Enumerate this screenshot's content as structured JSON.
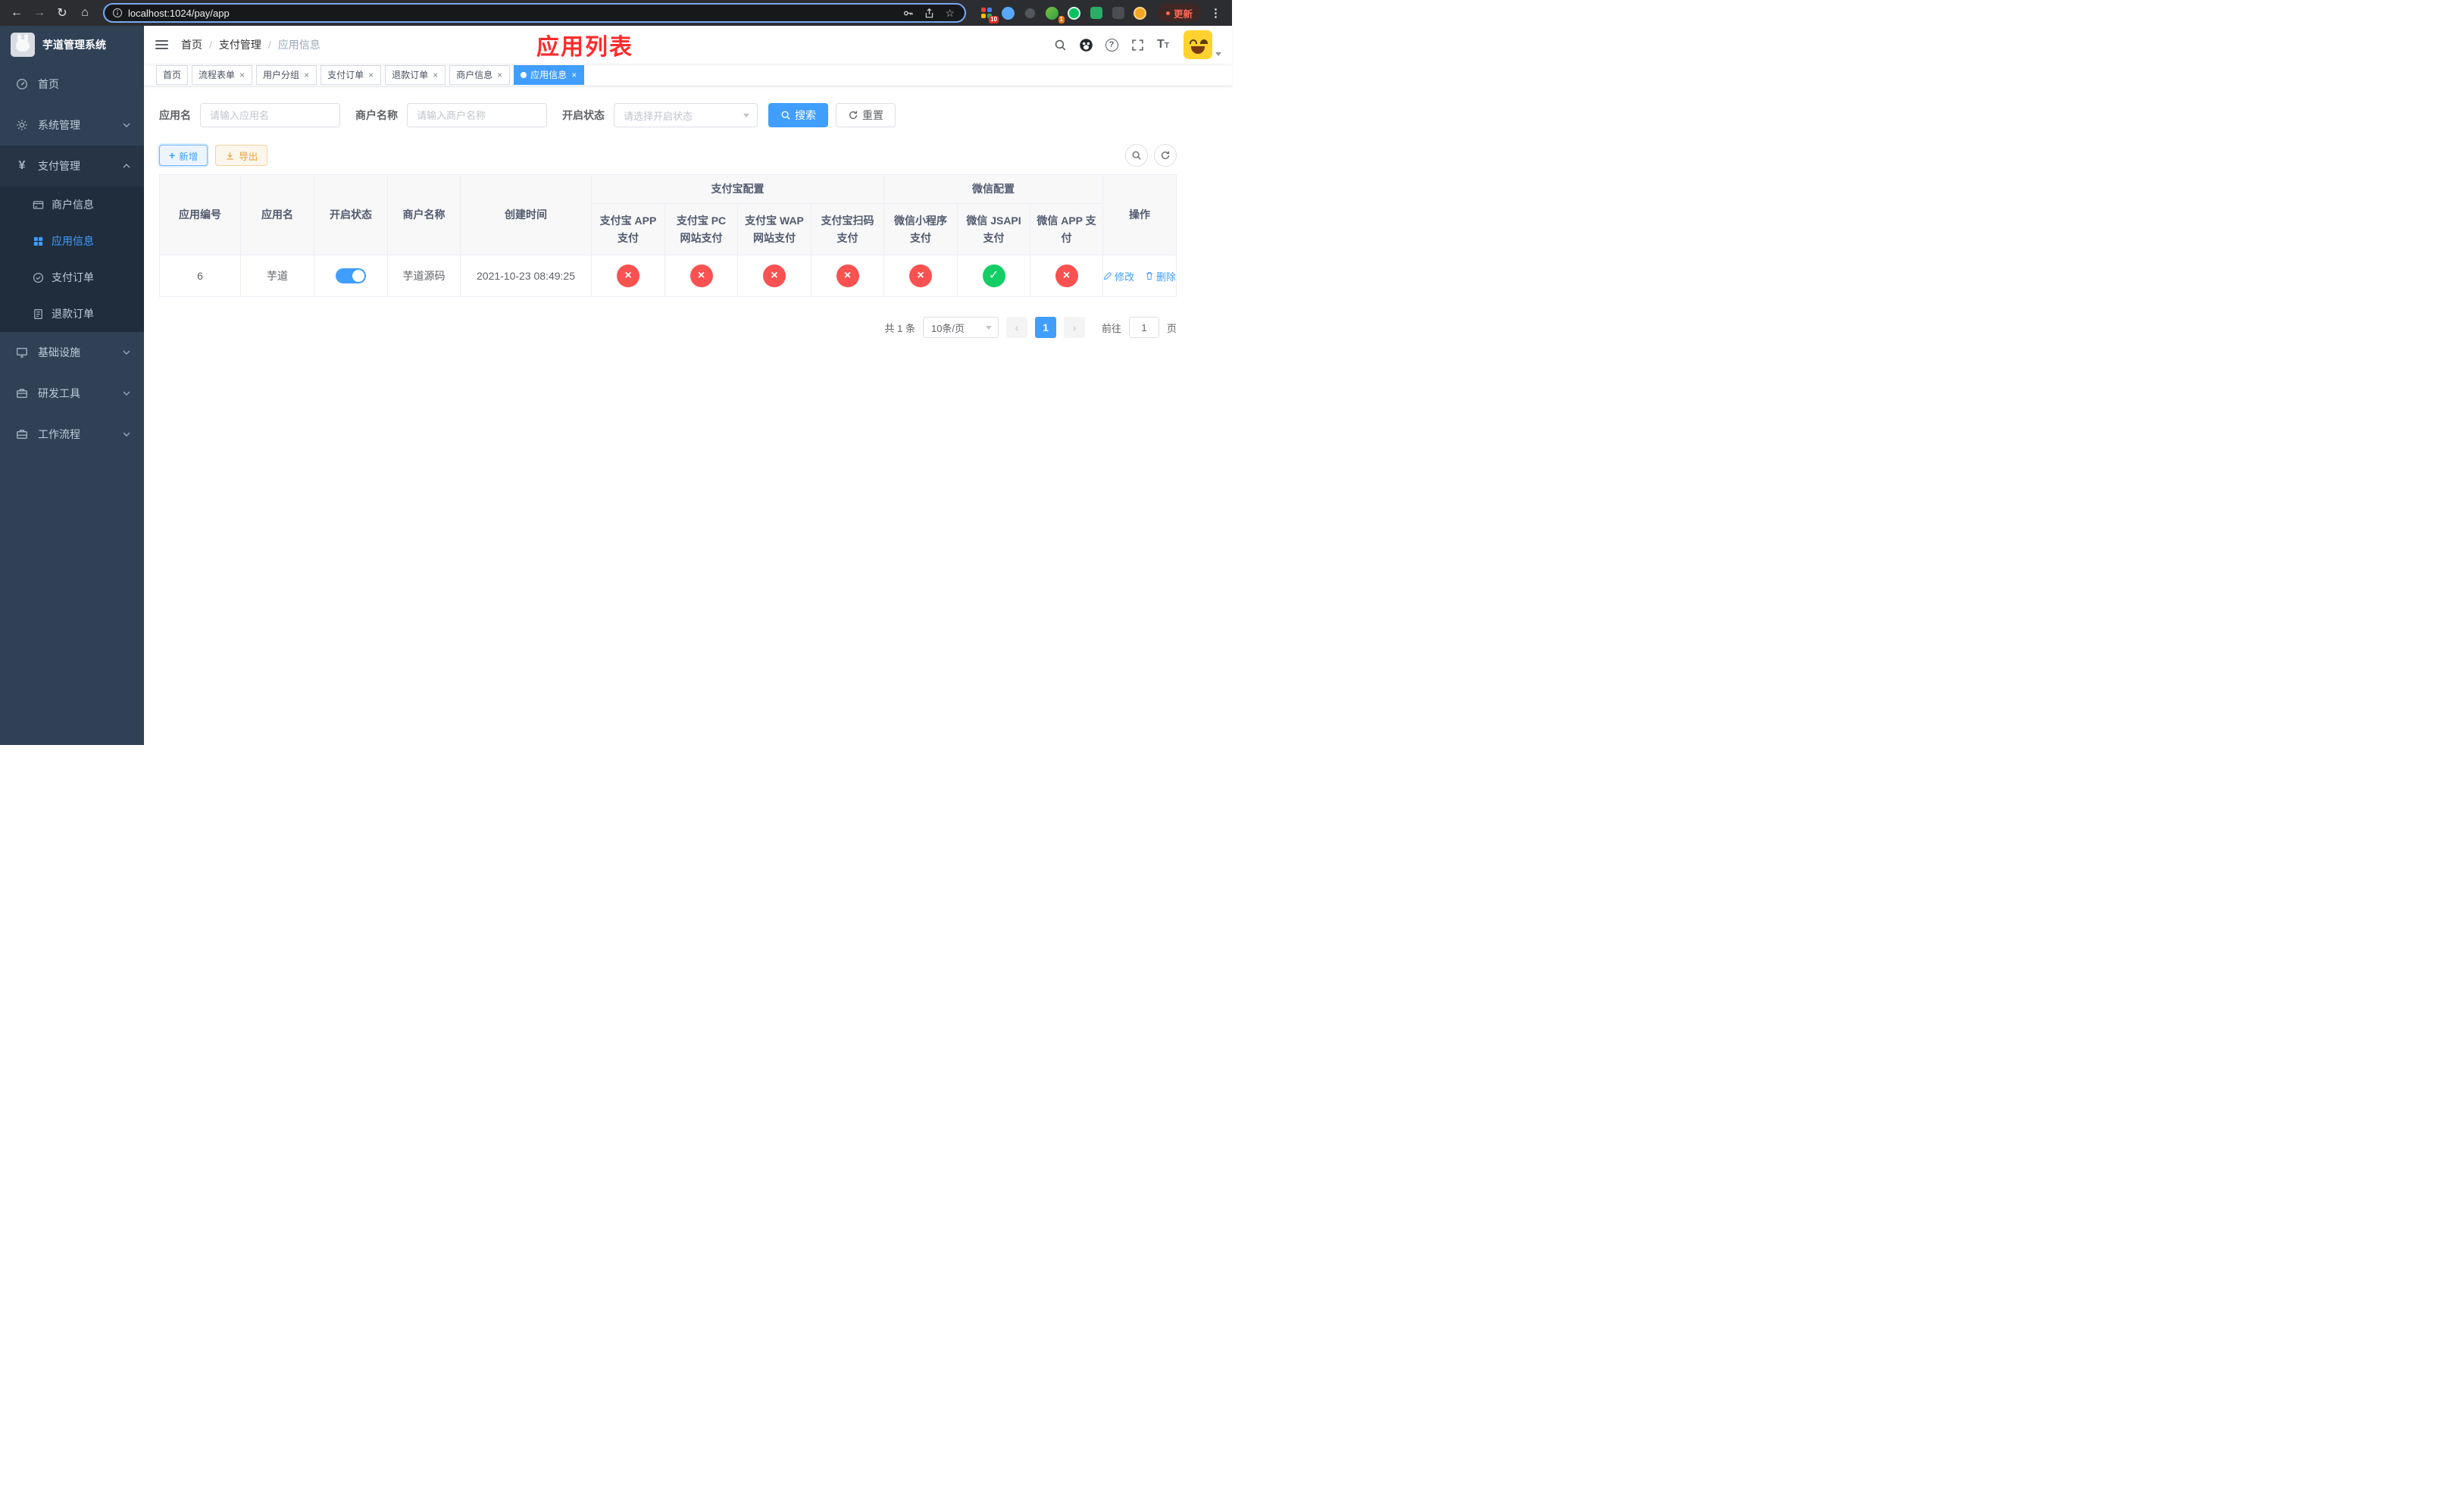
{
  "colors": {
    "accent": "#409eff",
    "success": "#13ce66",
    "danger": "#fa5151",
    "warning": "#e6a23c",
    "sidebar_bg": "#304156",
    "sidebar_submenu_bg": "#1f2d3d",
    "annotation_red": "#ff2b2b"
  },
  "browser": {
    "url": "localhost:1024/pay/app",
    "update_label": "更新",
    "grid_extension_badge": "10",
    "parrot_extension_badge": "1",
    "icons": [
      "back-icon",
      "forward-icon",
      "reload-icon",
      "home-icon",
      "info-icon",
      "key-icon",
      "share-icon",
      "star-icon",
      "kebab-menu-icon"
    ]
  },
  "sidebar": {
    "logo_title": "芋道管理系统",
    "items": [
      {
        "label": "首页",
        "icon": "dashboard-icon"
      },
      {
        "label": "系统管理",
        "icon": "gear-icon"
      },
      {
        "label": "支付管理",
        "icon": "yen-icon"
      },
      {
        "label": "商户信息",
        "icon": "bank-card-icon"
      },
      {
        "label": "应用信息",
        "icon": "app-grid-icon"
      },
      {
        "label": "支付订单",
        "icon": "order-icon"
      },
      {
        "label": "退款订单",
        "icon": "refund-doc-icon"
      },
      {
        "label": "基础设施",
        "icon": "infrastructure-icon"
      },
      {
        "label": "研发工具",
        "icon": "dev-tools-icon"
      },
      {
        "label": "工作流程",
        "icon": "workflow-icon"
      }
    ]
  },
  "header": {
    "breadcrumb": [
      {
        "label": "首页"
      },
      {
        "label": "支付管理"
      },
      {
        "label": "应用信息"
      }
    ],
    "annotation": "应用列表",
    "icons": [
      "search-icon",
      "github-icon",
      "help-icon",
      "fullscreen-icon",
      "font-size-icon",
      "avatar",
      "chevron-down-icon"
    ]
  },
  "tabs": [
    {
      "label": "首页"
    },
    {
      "label": "流程表单"
    },
    {
      "label": "用户分组"
    },
    {
      "label": "支付订单"
    },
    {
      "label": "退款订单"
    },
    {
      "label": "商户信息"
    },
    {
      "label": "应用信息"
    }
  ],
  "filters": {
    "app_name_label": "应用名",
    "app_name_placeholder": "请输入应用名",
    "merchant_label": "商户名称",
    "merchant_placeholder": "请输入商户名称",
    "status_label": "开启状态",
    "status_placeholder": "请选择开启状态",
    "search_label": "搜索",
    "reset_label": "重置"
  },
  "toolbar": {
    "add_label": "新增",
    "export_label": "导出"
  },
  "table": {
    "group_headers": {
      "alipay": "支付宝配置",
      "wechat": "微信配置"
    },
    "columns": {
      "id": "应用编号",
      "name": "应用名",
      "status": "开启状态",
      "merchant": "商户名称",
      "created": "创建时间",
      "alipay_app": "支付宝 APP 支付",
      "alipay_pc": "支付宝 PC 网站支付",
      "alipay_wap": "支付宝 WAP 网站支付",
      "alipay_qr": "支付宝扫码支付",
      "wx_mini": "微信小程序支付",
      "wx_jsapi": "微信 JSAPI 支付",
      "wx_app": "微信 APP 支付",
      "actions": "操作"
    },
    "row": {
      "id": "6",
      "name": "芋道",
      "enabled": true,
      "merchant": "芋道源码",
      "created": "2021-10-23 08:49:25",
      "statuses": [
        false,
        false,
        false,
        false,
        false,
        true,
        false
      ],
      "edit_label": "修改",
      "delete_label": "删除"
    }
  },
  "pagination": {
    "total": "共 1 条",
    "page_size": "10条/页",
    "current": "1",
    "goto_label": "前往",
    "goto_value": "1",
    "unit_label": "页"
  }
}
